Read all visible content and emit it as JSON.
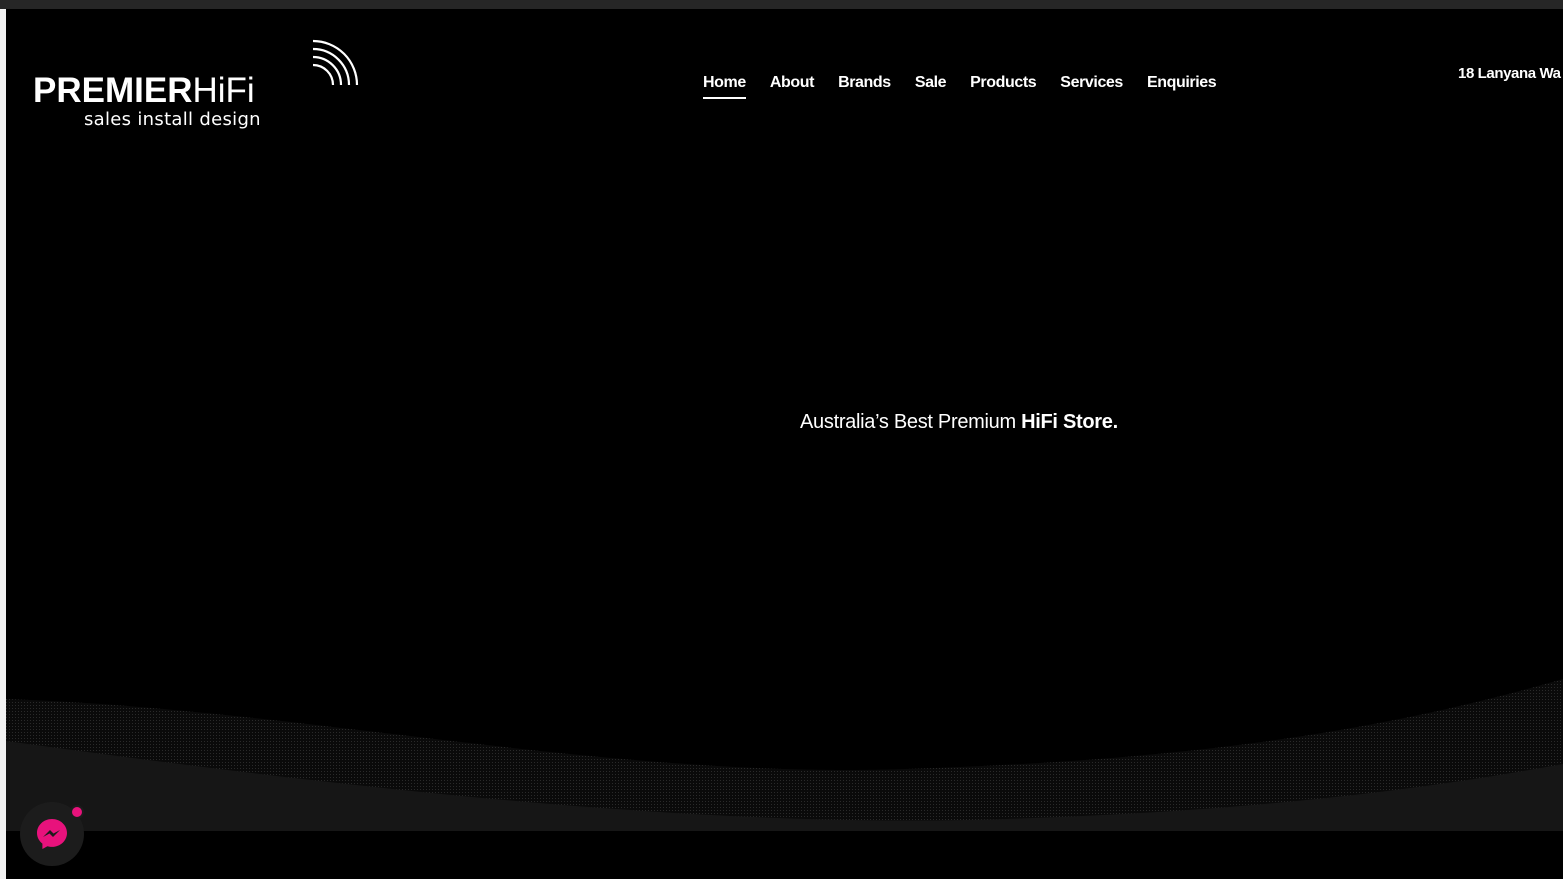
{
  "logo": {
    "word_bold": "PREMIER",
    "word_thin": "HiFi",
    "tagline": "sales install design"
  },
  "nav": {
    "items": [
      {
        "label": "Home",
        "active": true
      },
      {
        "label": "About"
      },
      {
        "label": "Brands"
      },
      {
        "label": "Sale"
      },
      {
        "label": "Products"
      },
      {
        "label": "Services"
      },
      {
        "label": "Enquiries"
      }
    ]
  },
  "header": {
    "address": "18 Lanyana Wa"
  },
  "hero": {
    "tagline_regular": "Australia’s Best Premium ",
    "tagline_bold": "HiFi Store."
  },
  "chat_widget": {
    "icon": "messenger-icon",
    "badge_color": "#e8127c",
    "accent_color": "#e8127c"
  },
  "colors": {
    "background": "#000000",
    "text": "#ffffff",
    "wave": "#1a1a1a"
  }
}
